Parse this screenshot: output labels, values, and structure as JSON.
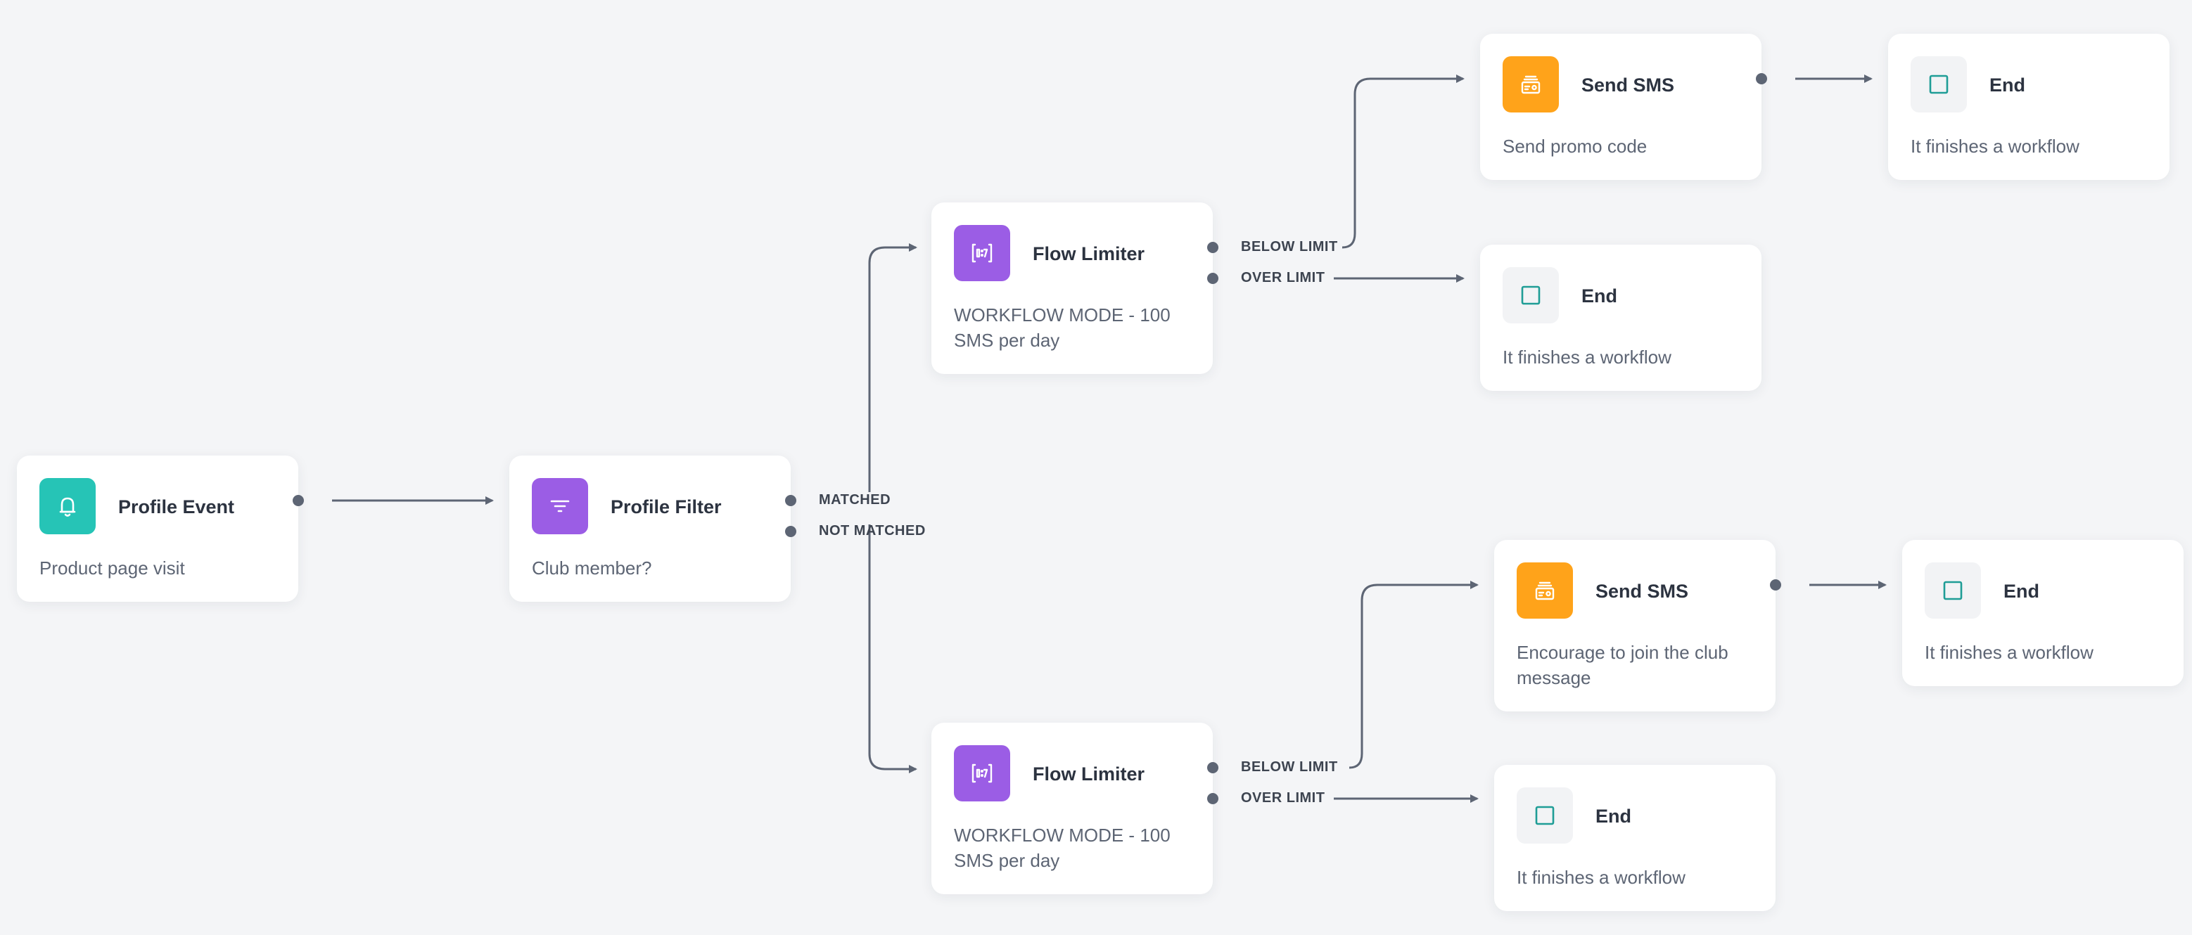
{
  "colors": {
    "background": "#f4f5f7",
    "event_icon_bg": "#26c4b6",
    "filter_icon_bg": "#9b5de5",
    "limiter_icon_bg": "#9b5de5",
    "sms_icon_bg": "#ffa31a",
    "end_icon_bg": "#f2f3f5",
    "end_icon_stroke": "#1f9d96",
    "connector": "#5d6574"
  },
  "nodes": {
    "profile_event": {
      "title": "Profile Event",
      "desc": "Product page visit",
      "icon": "bell-icon"
    },
    "profile_filter": {
      "title": "Profile Filter",
      "desc": "Club member?",
      "icon": "filter-icon",
      "port_matched": "MATCHED",
      "port_not_matched": "NOT MATCHED"
    },
    "flow_limiter_top": {
      "title": "Flow Limiter",
      "desc": "WORKFLOW MODE - 100 SMS per day",
      "icon": "flow-limiter-icon",
      "port_below": "BELOW LIMIT",
      "port_over": "OVER LIMIT"
    },
    "flow_limiter_bottom": {
      "title": "Flow Limiter",
      "desc": "WORKFLOW MODE - 100 SMS per day",
      "icon": "flow-limiter-icon",
      "port_below": "BELOW LIMIT",
      "port_over": "OVER LIMIT"
    },
    "send_sms_top": {
      "title": "Send SMS",
      "desc": "Send promo code",
      "icon": "sms-icon"
    },
    "send_sms_bottom": {
      "title": "Send SMS",
      "desc": "Encourage to join the club message",
      "icon": "sms-icon"
    },
    "end_1": {
      "title": "End",
      "desc": "It finishes a workflow",
      "icon": "end-square-icon"
    },
    "end_2": {
      "title": "End",
      "desc": "It finishes a workflow",
      "icon": "end-square-icon"
    },
    "end_3": {
      "title": "End",
      "desc": "It finishes a workflow",
      "icon": "end-square-icon"
    },
    "end_4": {
      "title": "End",
      "desc": "It finishes a workflow",
      "icon": "end-square-icon"
    }
  }
}
